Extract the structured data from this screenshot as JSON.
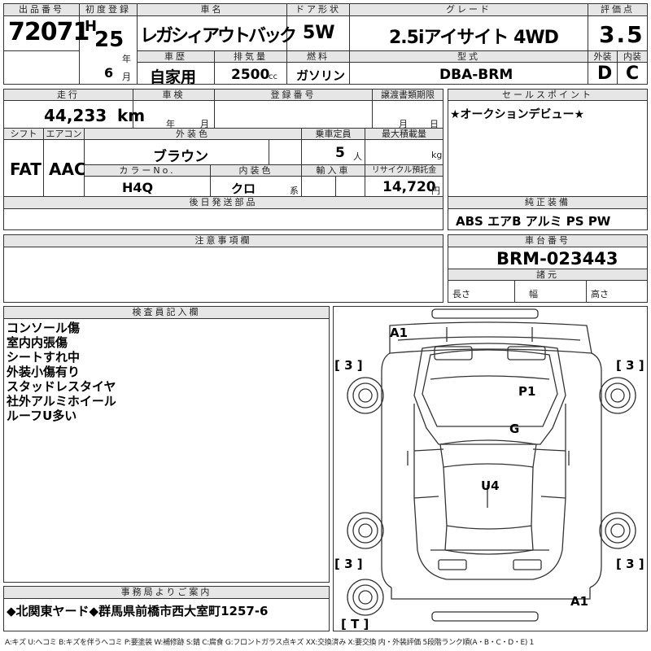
{
  "header": {
    "lot_no_label": "出品番号",
    "lot_no": "72071",
    "first_reg_label": "初度登録",
    "era": "H",
    "year": "25",
    "year_unit": "年",
    "month": "6",
    "month_unit": "月",
    "car_name_label": "車名",
    "car_name": "レガシィアウトバック",
    "doors_label": "ドア形状",
    "doors": "5W",
    "grade_label": "グレード",
    "grade": "2.5iアイサイト 4WD",
    "score_label": "評価点",
    "score": "3.5",
    "history_label": "車歴",
    "history": "自家用",
    "displacement_label": "排気量",
    "displacement": "2500",
    "displacement_unit": "cc",
    "fuel_label": "燃料",
    "fuel": "ガソリン",
    "model_label": "型式",
    "model": "DBA-BRM",
    "exterior_label": "外装",
    "exterior": "D",
    "interior_label": "内装",
    "interior": "C"
  },
  "details": {
    "mileage_label": "走行",
    "mileage": "44,233",
    "mileage_unit": "km",
    "inspection_label": "車検",
    "inspection_year_unit": "年",
    "inspection_month_unit": "月",
    "reg_no_label": "登録番号",
    "transfer_label": "譲渡書類期限",
    "transfer_month_unit": "月",
    "transfer_day_unit": "日",
    "shift_label": "シフト",
    "shift": "FAT",
    "ac_label": "エアコン",
    "ac": "AAC",
    "color_label": "外装色",
    "color": "ブラウン",
    "capacity_label": "乗車定員",
    "capacity": "5",
    "capacity_unit": "人",
    "load_label": "最大積載量",
    "load_unit": "kg",
    "color_no_label": "カラーNo.",
    "color_no": "H4Q",
    "interior_color_label": "内装色",
    "interior_color": "クロ",
    "interior_color_unit": "系",
    "import_label": "輸入車",
    "recycle_label": "リサイクル預託金",
    "recycle": "14,720",
    "recycle_unit": "円",
    "later_parts_label": "後日発送部品"
  },
  "sales_point": {
    "label": "セールスポイント",
    "text": "★オークションデビュー★"
  },
  "equipment": {
    "label": "純正装備",
    "text": "ABS エアB アルミ PS PW"
  },
  "notes": {
    "label": "注意事項欄"
  },
  "chassis": {
    "label": "車台番号",
    "value": "BRM-023443",
    "specs_label": "諸元",
    "length_label": "長さ",
    "width_label": "幅",
    "height_label": "高さ"
  },
  "inspector": {
    "label": "検査員記入欄",
    "lines": [
      "コンソール傷",
      "室内内張傷",
      "シートすれ中",
      "外装小傷有り",
      "スタッドレスタイヤ",
      "社外アルミホイール",
      "ルーフU多い"
    ]
  },
  "office": {
    "label": "事務局よりご案内",
    "text": "◆北関東ヤード◆群馬県前橋市西大室町1257-6"
  },
  "diagram": {
    "marks": [
      "A1",
      "P1",
      "G",
      "U4",
      "A1"
    ],
    "tires": [
      "[ 3 ]",
      "[ 3 ]",
      "[ 3 ]",
      "[ 3 ]",
      "[ T ]"
    ]
  },
  "legend": "A:キズ U:ヘコミ B:キズを伴うヘコミ P:要塗装 W:補修跡 S:錆 C:腐食 G:フロントガラス点キズ XX:交換済み X:要交換 内・外装評価 5段階ランク順(A・B・C・D・E) 1"
}
